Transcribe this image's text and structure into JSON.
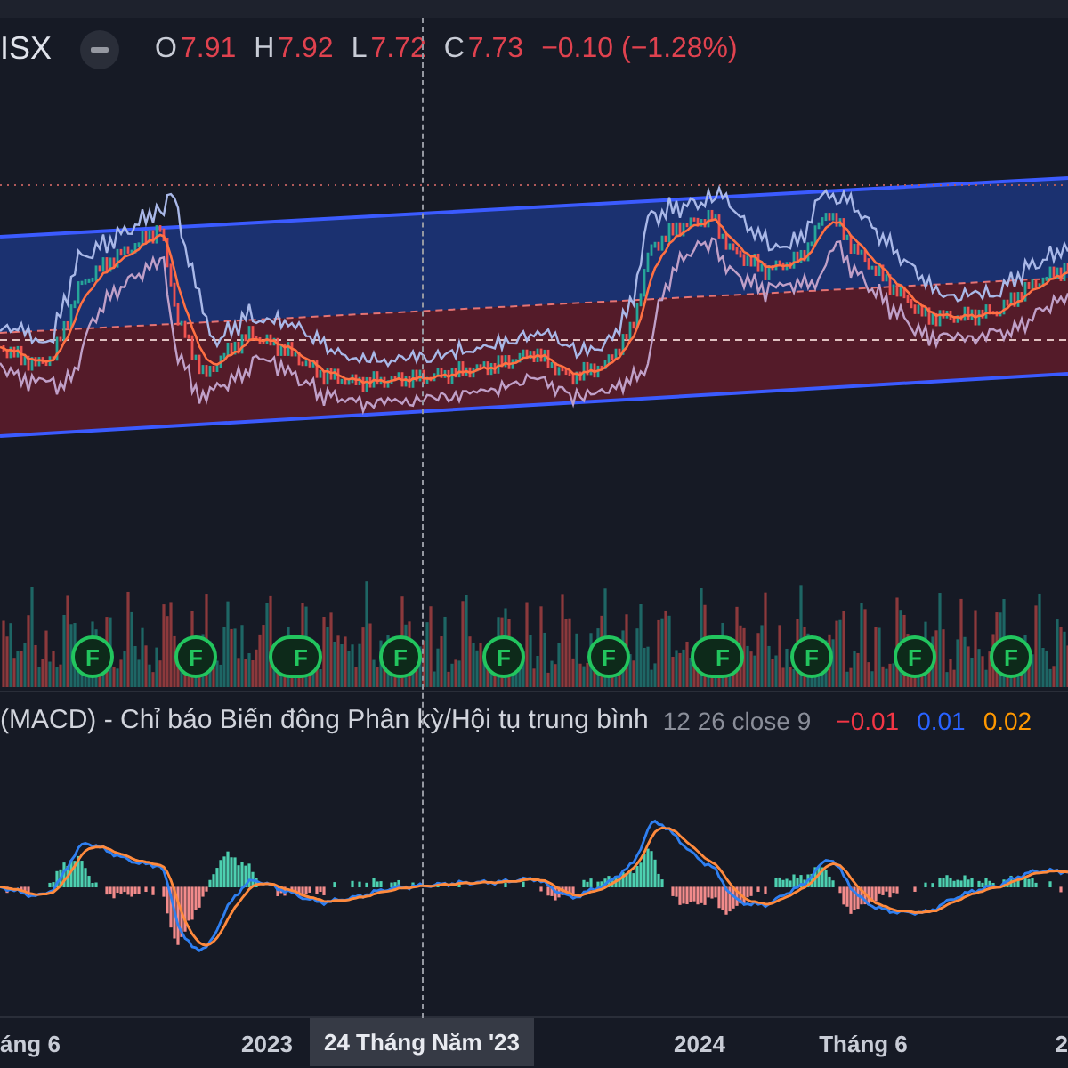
{
  "legend": {
    "symbol": "ISX",
    "ohlc": [
      {
        "label": "O",
        "value": "7.91"
      },
      {
        "label": "H",
        "value": "7.92"
      },
      {
        "label": "L",
        "value": "7.72"
      },
      {
        "label": "C",
        "value": "7.73"
      }
    ],
    "change": "−0.10 (−1.28%)"
  },
  "markers": [
    {
      "label": "F",
      "kind": "single"
    },
    {
      "label": "F",
      "kind": "single"
    },
    {
      "label": "F",
      "kind": "double"
    },
    {
      "label": "F",
      "kind": "single"
    },
    {
      "label": "F",
      "kind": "single"
    },
    {
      "label": "F",
      "kind": "single"
    },
    {
      "label": "F",
      "kind": "double"
    },
    {
      "label": "F",
      "kind": "single"
    },
    {
      "label": "F",
      "kind": "single"
    },
    {
      "label": "F",
      "kind": "single"
    }
  ],
  "macd": {
    "title": "(MACD) - Chỉ báo Biến động Phân kỳ/Hội tụ trung bình",
    "params": "12 26 close 9",
    "values": [
      {
        "text": "−0.01",
        "color": "#f23645"
      },
      {
        "text": "0.01",
        "color": "#2962ff"
      },
      {
        "text": "0.02",
        "color": "#ff9800"
      }
    ]
  },
  "time_axis": [
    {
      "label": "áng 6",
      "kind": "tick"
    },
    {
      "label": "2023",
      "kind": "tick"
    },
    {
      "label": "24 Tháng Năm '23",
      "kind": "cursor"
    },
    {
      "label": "2024",
      "kind": "tick"
    },
    {
      "label": "Tháng 6",
      "kind": "tick"
    },
    {
      "label": "2",
      "kind": "tick"
    }
  ]
}
